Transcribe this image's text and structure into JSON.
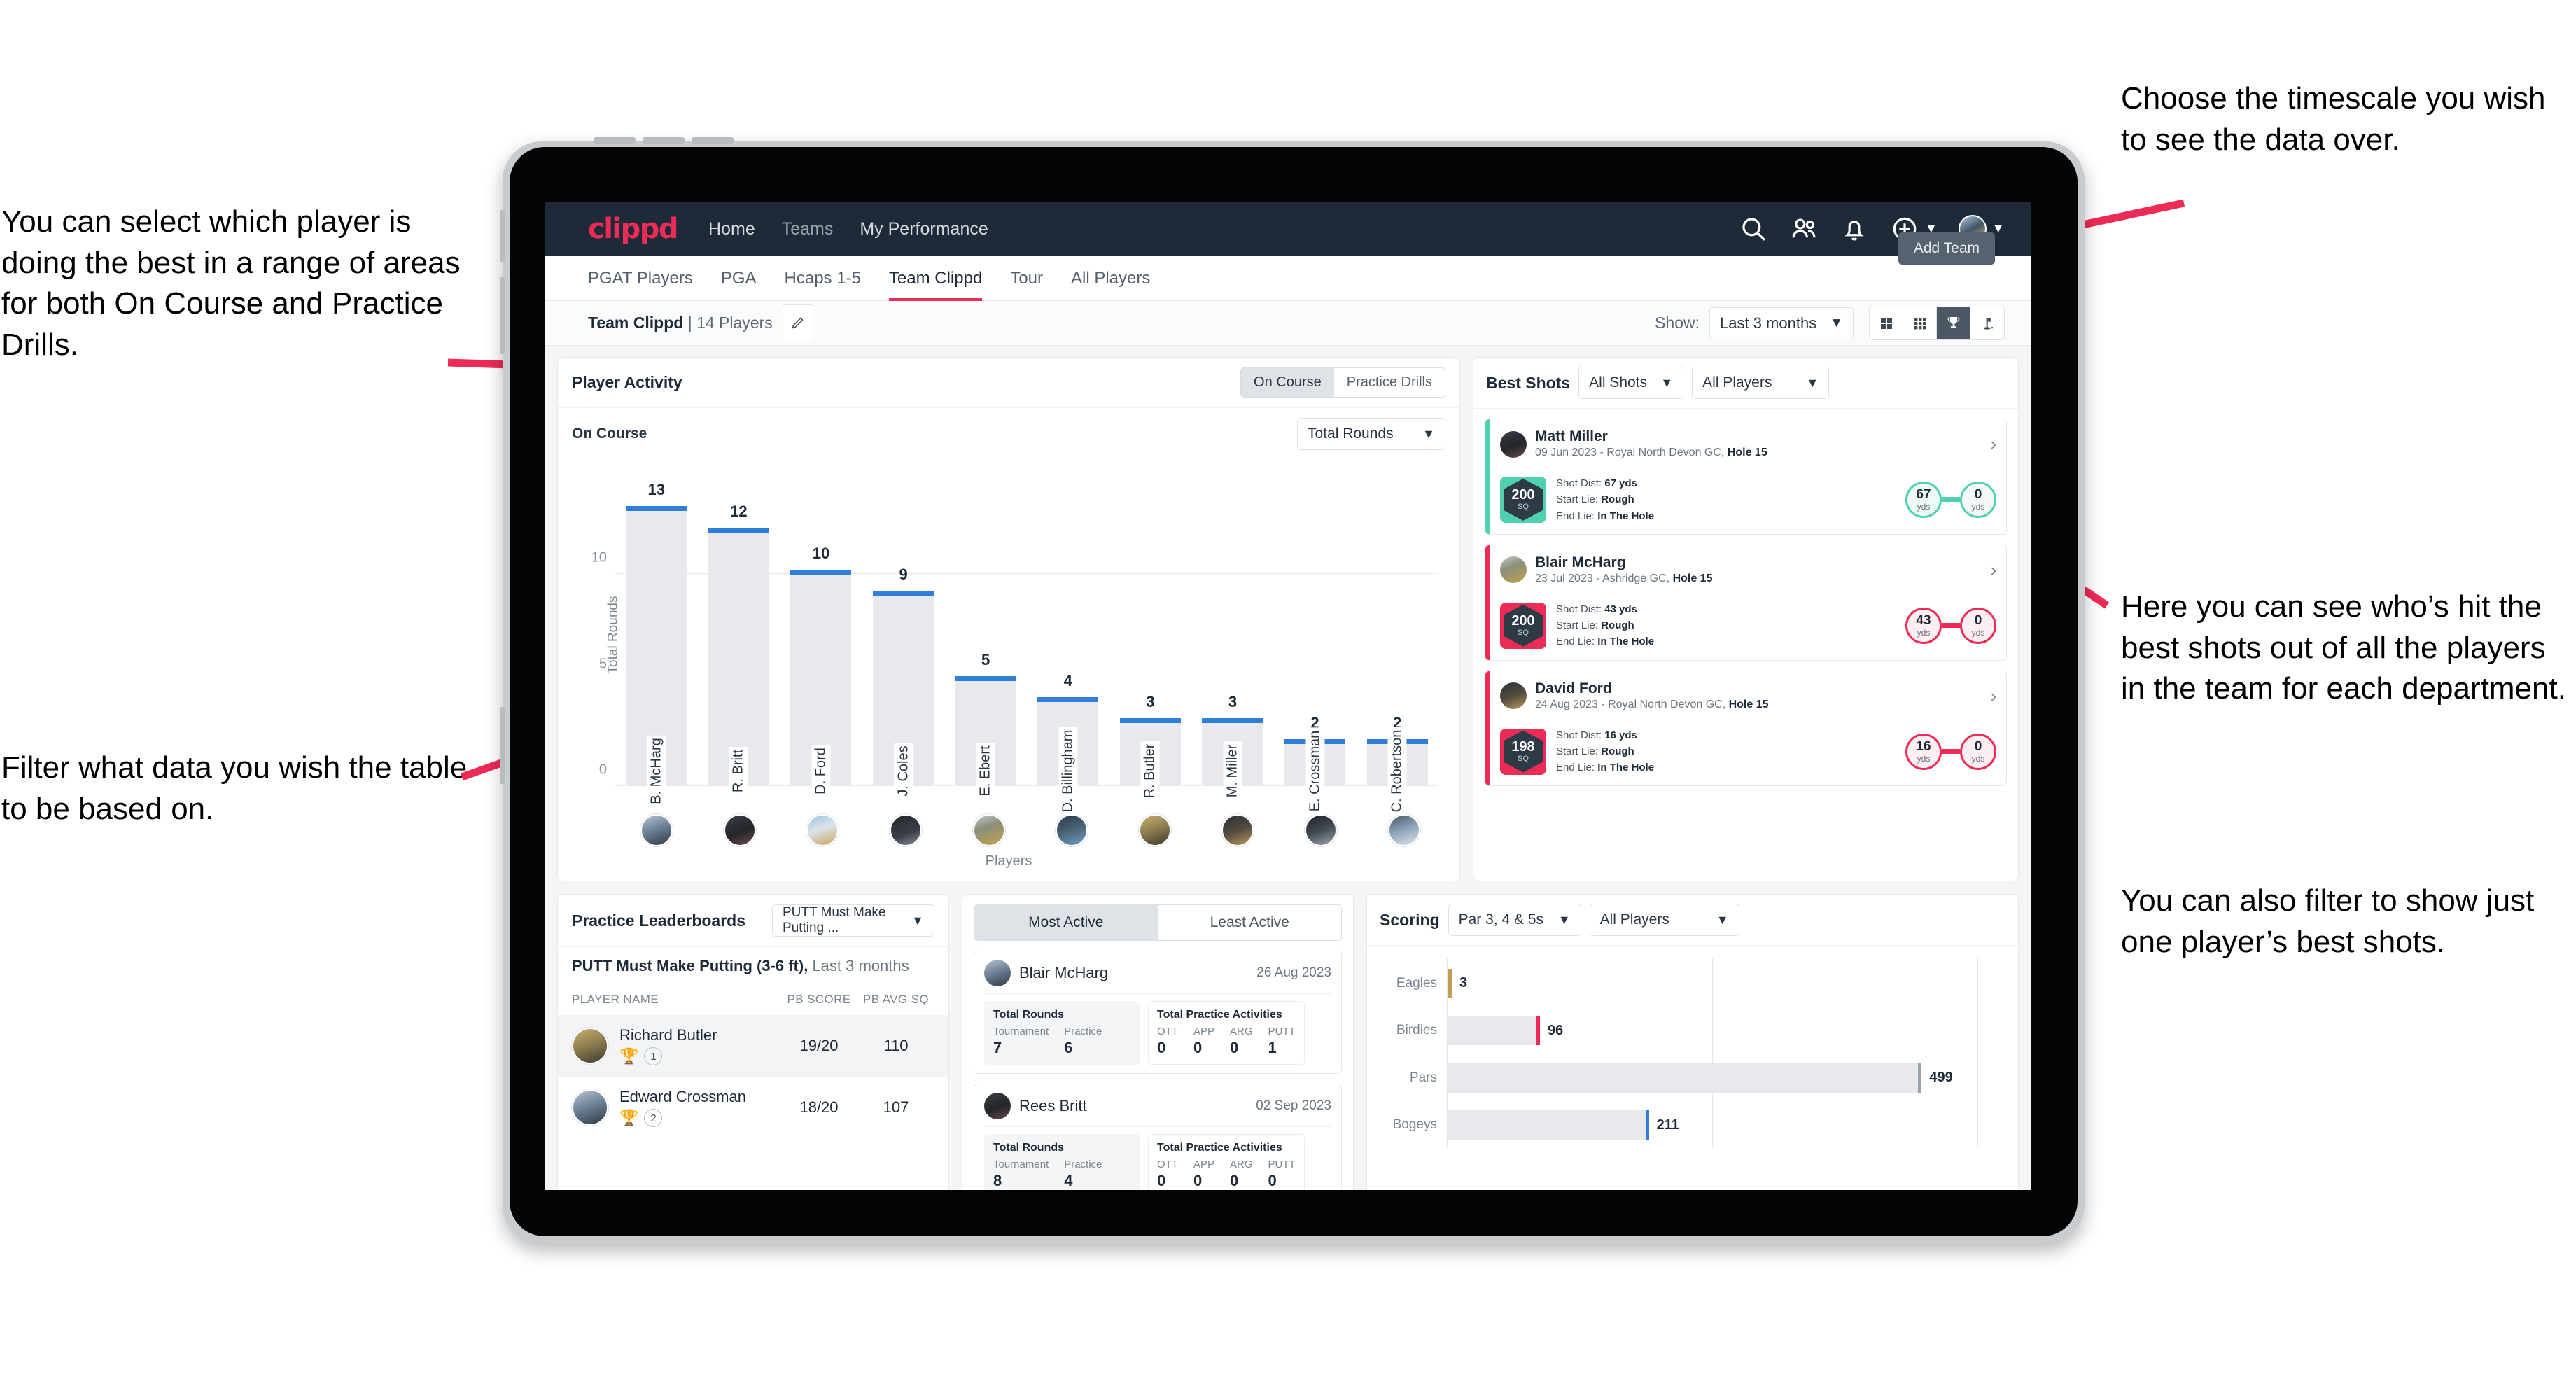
{
  "annotations": {
    "left_top": "You can select which player is doing the best in a range of areas for both On Course and Practice Drills.",
    "left_bottom": "Filter what data you wish the table to be based on.",
    "right_top": "Choose the timescale you wish to see the data over.",
    "right_middle": "Here you can see who’s hit the best shots out of all the players in the team for each department.",
    "right_bottom": "You can also filter to show just one player’s best shots."
  },
  "topnav": {
    "logo": "clippd",
    "links": [
      {
        "label": "Home",
        "active": true
      },
      {
        "label": "Teams",
        "active": false
      },
      {
        "label": "My Performance",
        "active": false
      }
    ],
    "icons": [
      "search-icon",
      "people-icon",
      "bell-icon",
      "plus-circle-icon",
      "avatar"
    ]
  },
  "tabs": [
    {
      "label": "PGAT Players",
      "active": false
    },
    {
      "label": "PGA",
      "active": false
    },
    {
      "label": "Hcaps 1-5",
      "active": false
    },
    {
      "label": "Team Clippd",
      "active": true
    },
    {
      "label": "Tour",
      "active": false
    },
    {
      "label": "All Players",
      "active": false
    }
  ],
  "tooltip": {
    "add_team": "Add Team"
  },
  "toolbar": {
    "team_name": "Team Clippd",
    "team_divider": " | ",
    "player_count": "14 Players",
    "show_label": "Show:",
    "timescale_value": "Last 3 months",
    "view_toggles": [
      {
        "name": "grid-4-icon",
        "active": false
      },
      {
        "name": "grid-9-icon",
        "active": false
      },
      {
        "name": "trophy-icon",
        "active": true
      },
      {
        "name": "flag-pin-icon",
        "active": false
      }
    ]
  },
  "player_activity": {
    "title": "Player Activity",
    "segments": [
      {
        "label": "On Course",
        "active": true
      },
      {
        "label": "Practice Drills",
        "active": false
      }
    ],
    "subtitle": "On Course",
    "metric_select": "Total Rounds"
  },
  "chart_data": [
    {
      "type": "bar",
      "title": "Player Activity — On Course",
      "xlabel": "Players",
      "ylabel": "Total Rounds",
      "ylim": [
        0,
        14
      ],
      "yticks": [
        0,
        5,
        10
      ],
      "grid": true,
      "categories": [
        "B. McHarg",
        "R. Britt",
        "D. Ford",
        "J. Coles",
        "E. Ebert",
        "D. Billingham",
        "R. Butler",
        "M. Miller",
        "E. Crossman",
        "C. Robertson"
      ],
      "values": [
        13,
        12,
        10,
        9,
        5,
        4,
        3,
        3,
        2,
        2
      ],
      "bar_color": "#e7e9ec",
      "cap_color": "#2f7ed8"
    },
    {
      "type": "bar",
      "orientation": "horizontal",
      "title": "Scoring",
      "categories": [
        "Eagles",
        "Birdies",
        "Pars",
        "Bogeys"
      ],
      "values": [
        3,
        96,
        499,
        211
      ],
      "xlim": [
        0,
        560
      ],
      "bar_color": "#e7e9ec",
      "tip_colors": [
        "#c0a050",
        "#ec2b56",
        "#9aa3ad",
        "#2f7ed8"
      ]
    }
  ],
  "best_shots": {
    "title": "Best Shots",
    "shot_filter": "All Shots",
    "player_filter": "All Players",
    "items": [
      {
        "name": "Matt Miller",
        "meta_date": "09 Jun 2023 - Royal North Devon GC, ",
        "meta_hole": "Hole 15",
        "sq": "200",
        "sq_unit": "SQ",
        "accent": "#4fd1b0",
        "shot_dist_label": "Shot Dist: ",
        "shot_dist": "67 yds",
        "start_lie_label": "Start Lie: ",
        "start_lie": "Rough",
        "end_lie_label": "End Lie: ",
        "end_lie": "In The Hole",
        "from_value": "67",
        "from_unit": "yds",
        "to_value": "0",
        "to_unit": "yds"
      },
      {
        "name": "Blair McHarg",
        "meta_date": "23 Jul 2023 - Ashridge GC, ",
        "meta_hole": "Hole 15",
        "sq": "200",
        "sq_unit": "SQ",
        "accent": "#ec2b56",
        "shot_dist_label": "Shot Dist: ",
        "shot_dist": "43 yds",
        "start_lie_label": "Start Lie: ",
        "start_lie": "Rough",
        "end_lie_label": "End Lie: ",
        "end_lie": "In The Hole",
        "from_value": "43",
        "from_unit": "yds",
        "to_value": "0",
        "to_unit": "yds"
      },
      {
        "name": "David Ford",
        "meta_date": "24 Aug 2023 - Royal North Devon GC, ",
        "meta_hole": "Hole 15",
        "sq": "198",
        "sq_unit": "SQ",
        "accent": "#ec2b56",
        "shot_dist_label": "Shot Dist: ",
        "shot_dist": "16 yds",
        "start_lie_label": "Start Lie: ",
        "start_lie": "Rough",
        "end_lie_label": "End Lie: ",
        "end_lie": "In The Hole",
        "from_value": "16",
        "from_unit": "yds",
        "to_value": "0",
        "to_unit": "yds"
      }
    ]
  },
  "practice_leaderboards": {
    "title": "Practice Leaderboards",
    "drill_select": "PUTT Must Make Putting ...",
    "subtitle_bold": "PUTT Must Make Putting (3-6 ft),",
    "subtitle_light": " Last 3 months",
    "columns": [
      "PLAYER NAME",
      "PB SCORE",
      "PB AVG SQ"
    ],
    "rows": [
      {
        "name": "Richard Butler",
        "rank": "1",
        "pb_score": "19/20",
        "pb_avg_sq": "110",
        "highlight": true
      },
      {
        "name": "Edward Crossman",
        "rank": "2",
        "pb_score": "18/20",
        "pb_avg_sq": "107",
        "highlight": false
      }
    ]
  },
  "activity_panel": {
    "tabs": [
      {
        "label": "Most Active",
        "active": true
      },
      {
        "label": "Least Active",
        "active": false
      }
    ],
    "items": [
      {
        "name": "Blair McHarg",
        "date": "26 Aug 2023",
        "rounds_title": "Total Rounds",
        "rounds": [
          {
            "label": "Tournament",
            "value": "7"
          },
          {
            "label": "Practice",
            "value": "6"
          }
        ],
        "practice_title": "Total Practice Activities",
        "practice": [
          {
            "label": "OTT",
            "value": "0"
          },
          {
            "label": "APP",
            "value": "0"
          },
          {
            "label": "ARG",
            "value": "0"
          },
          {
            "label": "PUTT",
            "value": "1"
          }
        ]
      },
      {
        "name": "Rees Britt",
        "date": "02 Sep 2023",
        "rounds_title": "Total Rounds",
        "rounds": [
          {
            "label": "Tournament",
            "value": "8"
          },
          {
            "label": "Practice",
            "value": "4"
          }
        ],
        "practice_title": "Total Practice Activities",
        "practice": [
          {
            "label": "OTT",
            "value": "0"
          },
          {
            "label": "APP",
            "value": "0"
          },
          {
            "label": "ARG",
            "value": "0"
          },
          {
            "label": "PUTT",
            "value": "0"
          }
        ]
      }
    ]
  },
  "scoring": {
    "title": "Scoring",
    "par_filter": "Par 3, 4 & 5s",
    "player_filter": "All Players"
  },
  "colors": {
    "brand_pink": "#ec2b56",
    "navy": "#1e2a38",
    "bar_blue": "#2f7ed8",
    "teal": "#4fd1b0",
    "gold": "#c0a050"
  }
}
